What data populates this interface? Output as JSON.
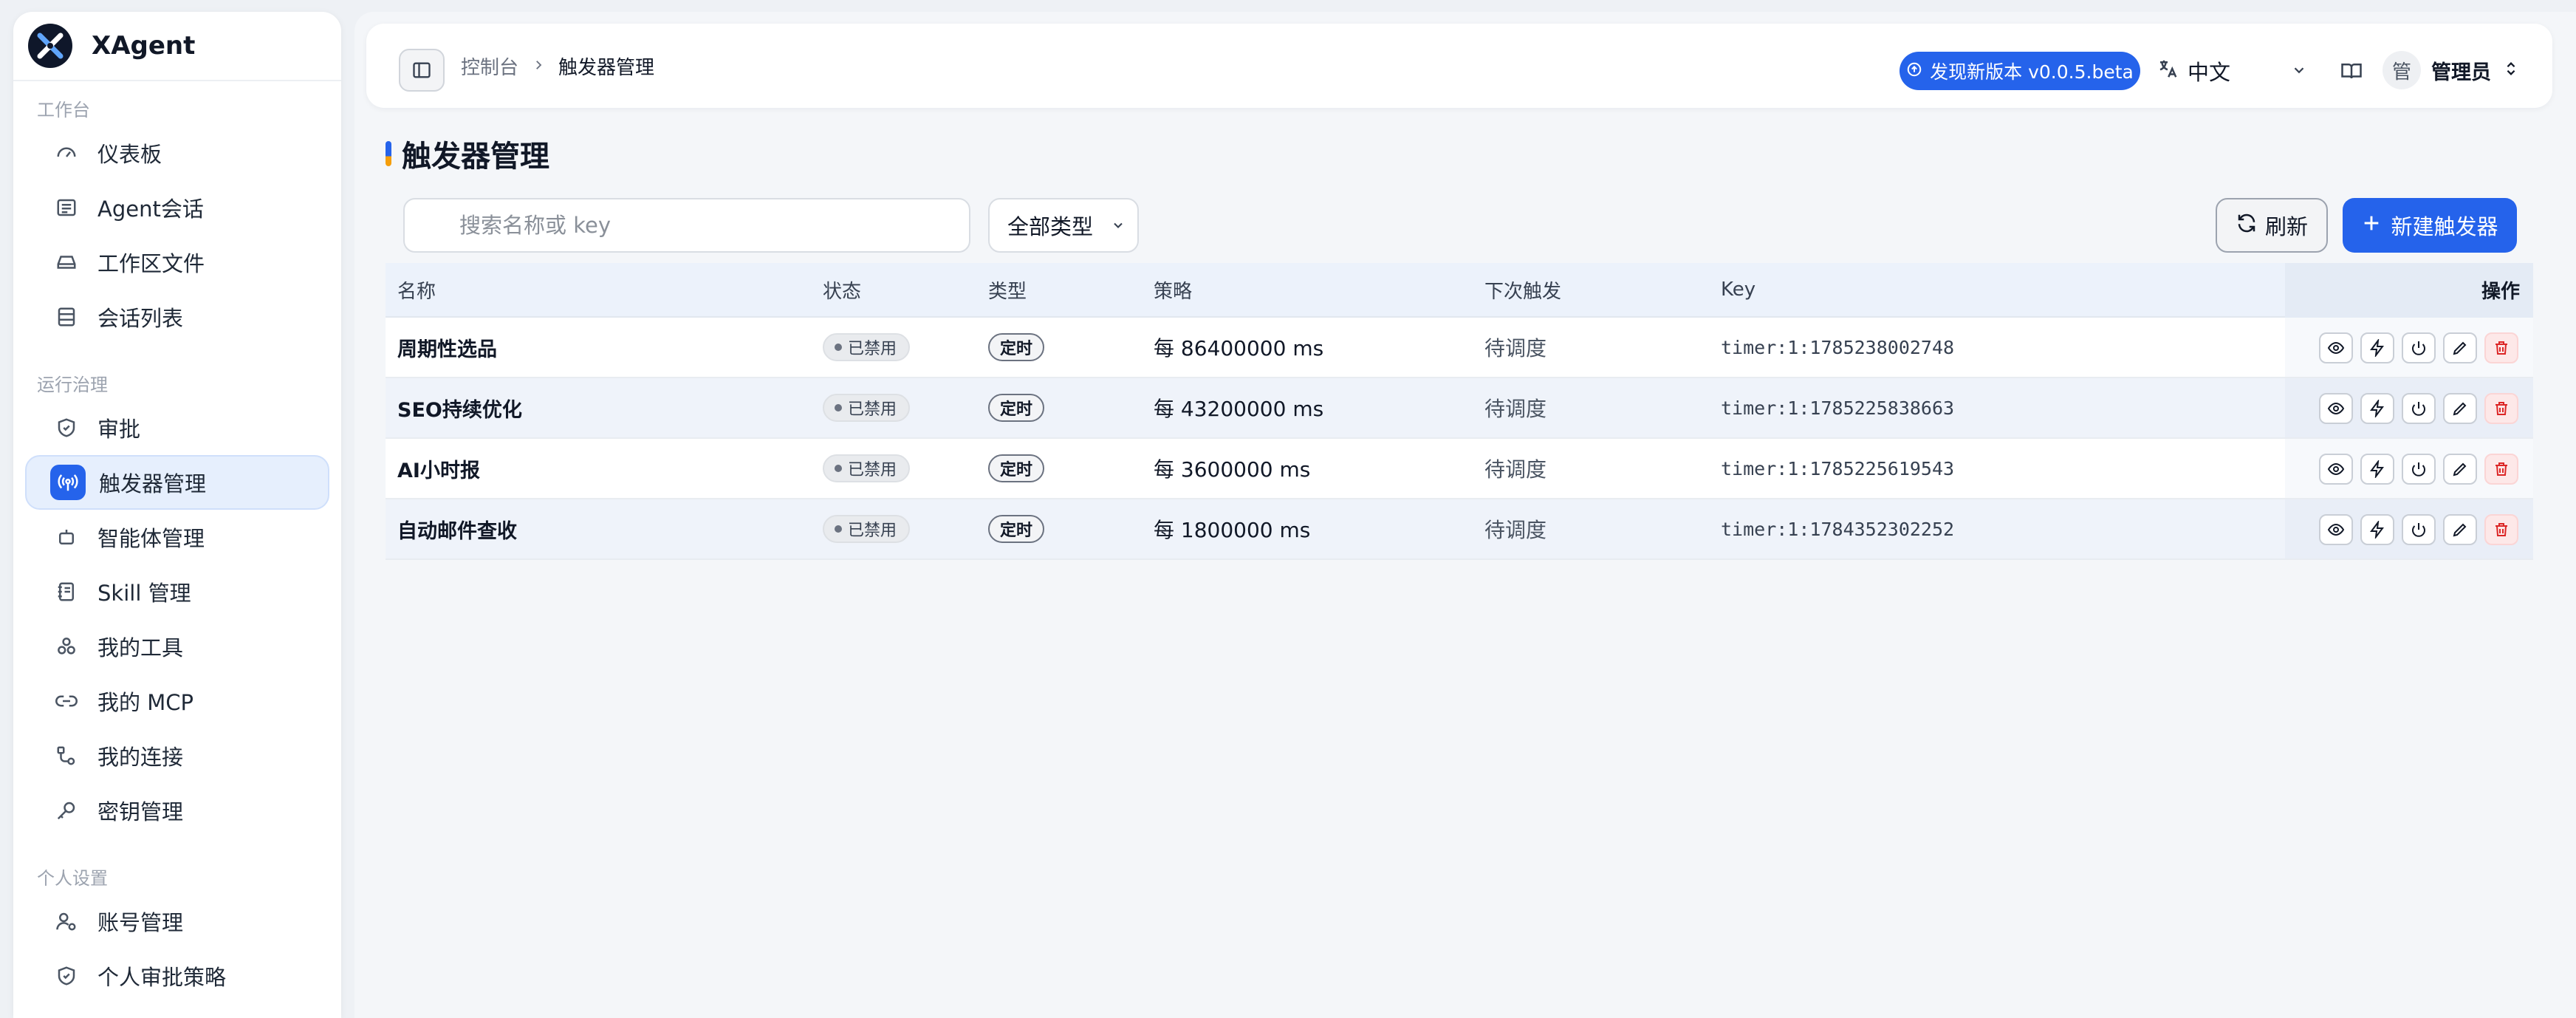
{
  "app": {
    "name": "XAgent"
  },
  "sidebar": {
    "sections": [
      {
        "title": "工作台",
        "items": [
          {
            "label": "仪表板",
            "icon": "gauge-icon",
            "active": false
          },
          {
            "label": "Agent会话",
            "icon": "chat-lines-icon",
            "active": false
          },
          {
            "label": "工作区文件",
            "icon": "drive-icon",
            "active": false
          },
          {
            "label": "会话列表",
            "icon": "list-icon",
            "active": false
          }
        ]
      },
      {
        "title": "运行治理",
        "items": [
          {
            "label": "审批",
            "icon": "shield-check-icon",
            "active": false
          },
          {
            "label": "触发器管理",
            "icon": "broadcast-icon",
            "active": true
          },
          {
            "label": "智能体管理",
            "icon": "robot-icon",
            "active": false
          },
          {
            "label": "Skill 管理",
            "icon": "notebook-icon",
            "active": false
          },
          {
            "label": "我的工具",
            "icon": "blocks-icon",
            "active": false
          },
          {
            "label": "我的 MCP",
            "icon": "link-icon",
            "active": false
          },
          {
            "label": "我的连接",
            "icon": "route-icon",
            "active": false
          },
          {
            "label": "密钥管理",
            "icon": "key-icon",
            "active": false
          }
        ]
      },
      {
        "title": "个人设置",
        "items": [
          {
            "label": "账号管理",
            "icon": "user-gear-icon",
            "active": false
          },
          {
            "label": "个人审批策略",
            "icon": "shield-icon",
            "active": false
          }
        ]
      }
    ]
  },
  "topbar": {
    "breadcrumb": [
      "控制台",
      "触发器管理"
    ],
    "version_badge": "发现新版本 v0.0.5.beta",
    "language": "中文",
    "user": {
      "avatar": "管",
      "name": "管理员"
    }
  },
  "page": {
    "title": "触发器管理",
    "search_placeholder": "搜索名称或 key",
    "type_filter": "全部类型",
    "refresh_label": "刷新",
    "new_label": "新建触发器"
  },
  "table": {
    "columns": [
      "名称",
      "状态",
      "类型",
      "策略",
      "下次触发",
      "Key",
      "操作"
    ],
    "rows": [
      {
        "name": "周期性选品",
        "status": "已禁用",
        "type": "定时",
        "policy": "每 86400000 ms",
        "next": "待调度",
        "key": "timer:1:1785238002748"
      },
      {
        "name": "SEO持续优化",
        "status": "已禁用",
        "type": "定时",
        "policy": "每 43200000 ms",
        "next": "待调度",
        "key": "timer:1:1785225838663"
      },
      {
        "name": "AI小时报",
        "status": "已禁用",
        "type": "定时",
        "policy": "每 3600000 ms",
        "next": "待调度",
        "key": "timer:1:1785225619543"
      },
      {
        "name": "自动邮件查收",
        "status": "已禁用",
        "type": "定时",
        "policy": "每 1800000 ms",
        "next": "待调度",
        "key": "timer:1:1784352302252"
      }
    ],
    "row_actions": [
      "eye-icon",
      "bolt-icon",
      "power-icon",
      "pencil-icon",
      "trash-icon"
    ]
  },
  "colors": {
    "accent": "#2563eb",
    "danger": "#dc2626",
    "title_marker": "#f59e0b"
  }
}
